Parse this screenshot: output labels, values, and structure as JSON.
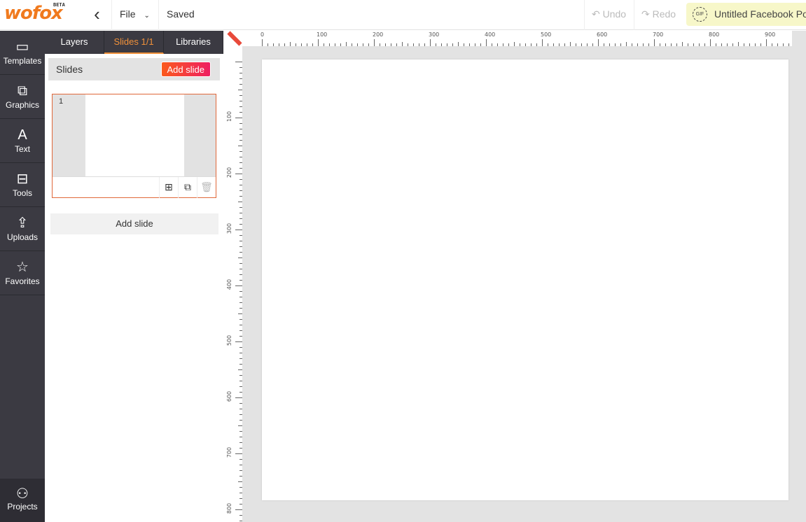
{
  "app": {
    "logo": "wofox",
    "beta": "BETA"
  },
  "topbar": {
    "file": "File",
    "status": "Saved",
    "undo": "Undo",
    "redo": "Redo",
    "title": "Untitled Facebook Post",
    "gif": "GIF"
  },
  "sidebar": {
    "items": [
      {
        "label": "Templates",
        "icon": "template-icon"
      },
      {
        "label": "Graphics",
        "icon": "graphics-icon"
      },
      {
        "label": "Text",
        "icon": "text-icon"
      },
      {
        "label": "Tools",
        "icon": "toolbox-icon"
      },
      {
        "label": "Uploads",
        "icon": "upload-icon"
      },
      {
        "label": "Favorites",
        "icon": "star-icon"
      }
    ],
    "projects": "Projects"
  },
  "panel": {
    "tabs": [
      "Layers",
      "Slides 1/1",
      "Libraries"
    ],
    "active_tab": 1,
    "heading": "Slides",
    "add_slide": "Add slide",
    "slide_number": "1",
    "add_slide_bottom": "Add slide"
  },
  "rulers": {
    "horizontal": [
      "0",
      "100",
      "200",
      "300",
      "400",
      "500",
      "600",
      "700",
      "800",
      "900"
    ],
    "vertical": [
      "100",
      "200",
      "300",
      "400",
      "500",
      "600",
      "700",
      "800"
    ]
  },
  "colors": {
    "accent": "#f0913a",
    "sidebar": "#3b3a42",
    "button_gradient": [
      "#fb5a1c",
      "#ee1e62"
    ]
  }
}
